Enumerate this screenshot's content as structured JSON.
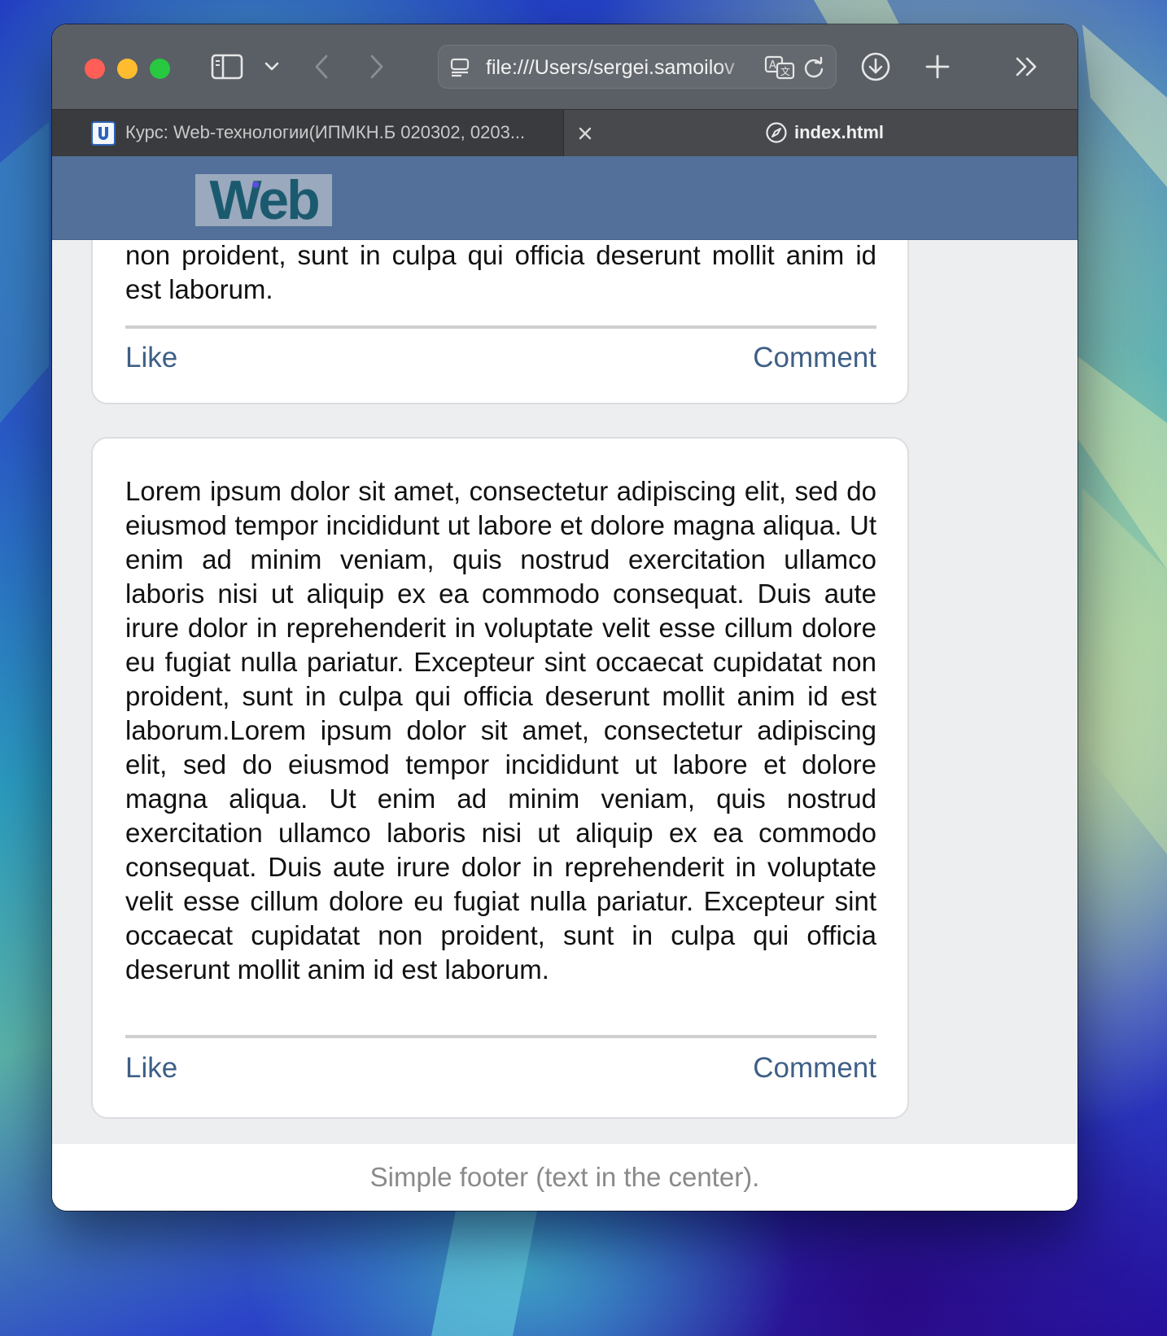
{
  "browser": {
    "address": "file:///Users/sergei.samoilov",
    "tabs": [
      {
        "title": "Курс: Web-технологии(ИПМКН.Б 020302, 0203...",
        "active": false
      },
      {
        "title": "index.html",
        "active": true
      }
    ]
  },
  "site": {
    "logo_text": "Web"
  },
  "posts": [
    {
      "text_partial": "non proident, sunt in culpa qui officia deserunt mollit anim id est laborum.",
      "like_label": "Like",
      "comment_label": "Comment"
    },
    {
      "text": "Lorem ipsum dolor sit amet, consectetur adipiscing elit, sed do eiusmod tempor incididunt ut labore et dolore magna aliqua. Ut enim ad minim veniam, quis nostrud exercitation ullamco laboris nisi ut aliquip ex ea commodo consequat. Duis aute irure dolor in reprehenderit in voluptate velit esse cillum dolore eu fugiat nulla pariatur. Excepteur sint occaecat cupidatat non proident, sunt in culpa qui officia deserunt mollit anim id est laborum.Lorem ipsum dolor sit amet, consectetur adipiscing elit, sed do eiusmod tempor incididunt ut labore et dolore magna aliqua. Ut enim ad minim veniam, quis nostrud exercitation ullamco laboris nisi ut aliquip ex ea commodo consequat. Duis aute irure dolor in reprehenderit in voluptate velit esse cillum dolore eu fugiat nulla pariatur. Excepteur sint occaecat cupidatat non proident, sunt in culpa qui officia deserunt mollit anim id est laborum.",
      "like_label": "Like",
      "comment_label": "Comment"
    }
  ],
  "footer": {
    "text": "Simple footer (text in the center)."
  },
  "icons": {
    "sidebar": "sidebar-icon",
    "chevron": "chevron-down-icon",
    "back": "back-arrow-icon",
    "forward": "forward-arrow-icon",
    "page": "page-icon",
    "translate": "translate-icon",
    "reload": "reload-icon",
    "downloads": "download-icon",
    "new_tab": "plus-icon",
    "more": "double-chevron-icon",
    "tab_close": "close-icon",
    "compass": "compass-icon"
  },
  "colors": {
    "header": "#527099",
    "link": "#3e5f86",
    "footer_text": "#8a8a8a"
  }
}
